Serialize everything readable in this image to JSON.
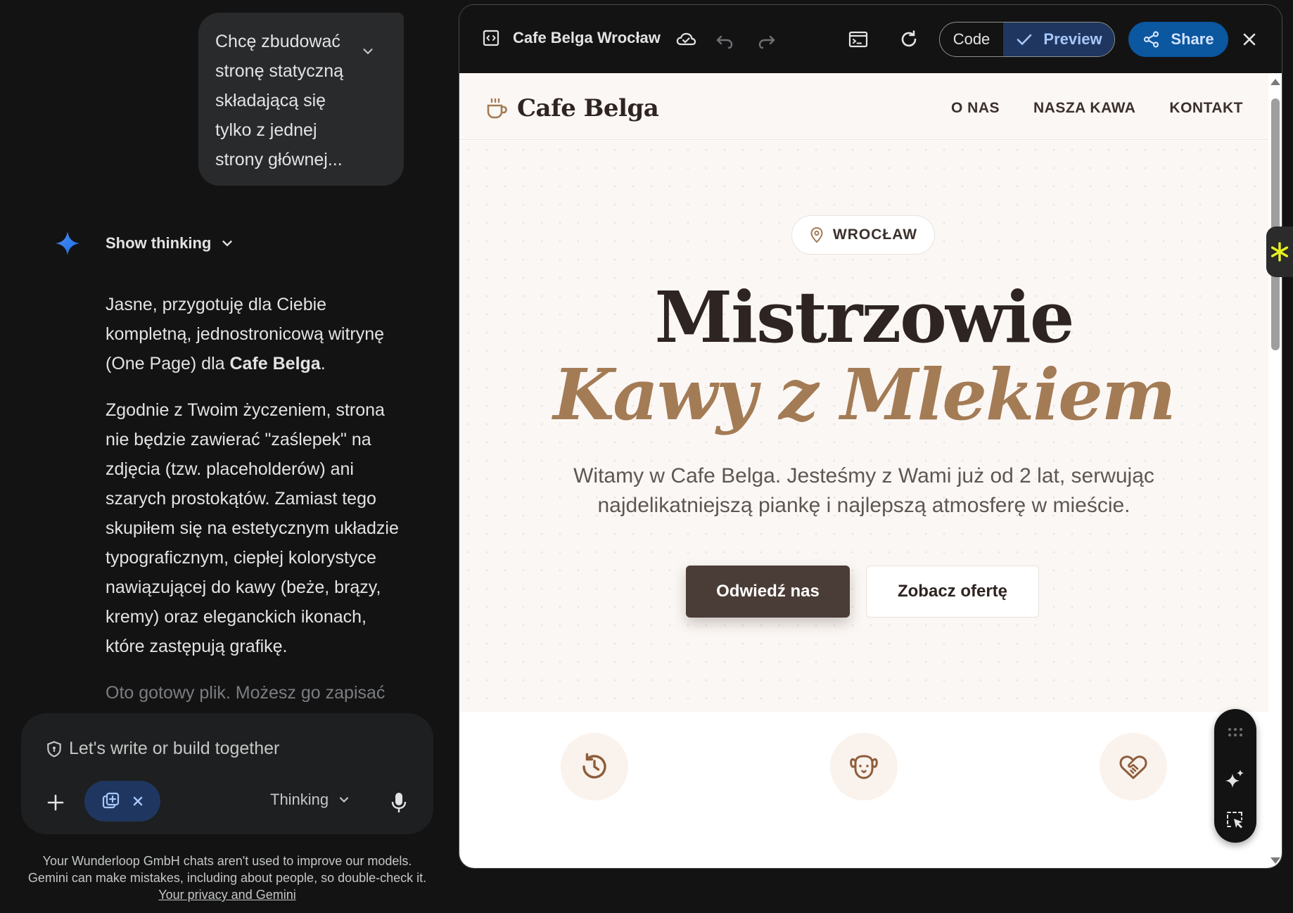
{
  "chat": {
    "user_message": "Chcę zbudować stronę statyczną składającą się tylko z jednej strony głównej...",
    "show_thinking_label": "Show thinking",
    "answer_p1_before": "Jasne, przygotuję dla Ciebie kompletną, jednostronicową witrynę (One Page) dla ",
    "answer_p1_bold": "Cafe Belga",
    "answer_p1_after": ".",
    "answer_p2": "Zgodnie z Twoim życzeniem, strona nie będzie zawierać \"zaślepek\" na zdjęcia (tzw. placeholderów) ani szarych prostokątów. Zamiast tego skupiłem się na estetycznym układzie typograficznym, ciepłej kolorystyce nawiązującej do kawy (beże, brązy, kremy) oraz eleganckich ikonach, które zastępują grafikę.",
    "answer_p3": "Oto gotowy plik. Możesz go zapisać"
  },
  "composer": {
    "placeholder": "Let's write or build together",
    "mode_label": "Thinking"
  },
  "disclaimer": {
    "text": "Your Wunderloop GmbH chats aren't used to improve our models. Gemini can make mistakes, including about people, so double-check it. ",
    "link": "Your privacy and Gemini"
  },
  "canvas": {
    "title": "Cafe Belga Wrocław",
    "code_label": "Code",
    "preview_label": "Preview",
    "share_label": "Share"
  },
  "site": {
    "brand": "Cafe Belga",
    "nav": [
      "O NAS",
      "NASZA KAWA",
      "KONTAKT"
    ],
    "location_pill": "WROCŁAW",
    "headline_1": "Mistrzowie",
    "headline_2": "Kawy z Mlekiem",
    "lead": "Witamy w Cafe Belga. Jesteśmy z Wami już od 2 lat, serwując najdelikatniejszą piankę i najlepszą atmosferę w mieście.",
    "cta_primary": "Odwiedź nas",
    "cta_secondary": "Zobacz ofertę",
    "feature_icons": [
      "history-icon",
      "dog-icon",
      "heart-handshake-icon"
    ]
  },
  "colors": {
    "accent_brown": "#a37b55",
    "dark_brown": "#4a3c36",
    "cream": "#fbf7f4",
    "gemini_blue": "#0b57a0"
  }
}
